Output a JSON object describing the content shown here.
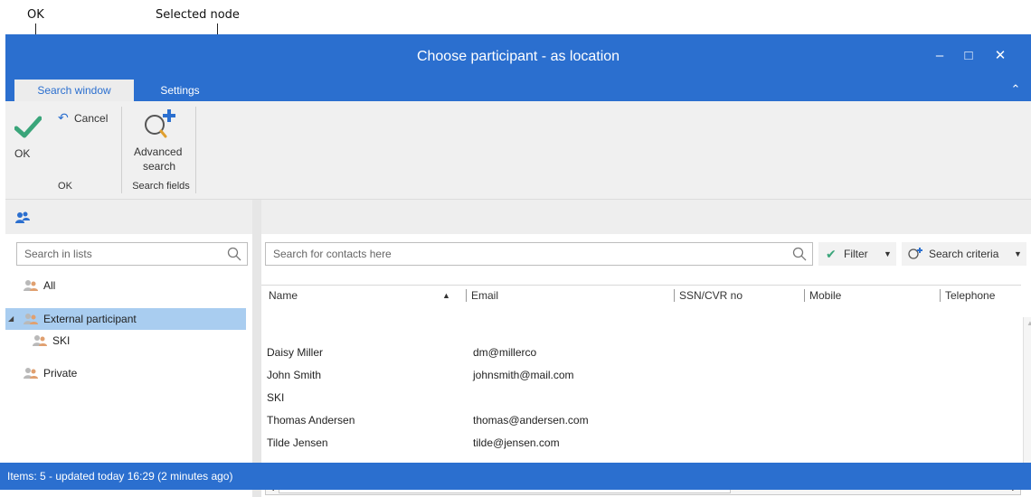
{
  "callouts": {
    "ok": "OK",
    "selected_node": "Selected node"
  },
  "window": {
    "title": "Choose participant - as location",
    "controls": {
      "minimize": "–",
      "maximize": "□",
      "close": "✕"
    }
  },
  "tabs": [
    {
      "label": "Search window"
    },
    {
      "label": "Settings"
    }
  ],
  "collapse_icon": "⌃",
  "ribbon": {
    "ok_label": "OK",
    "cancel_label": "Cancel",
    "advanced_search_label_1": "Advanced",
    "advanced_search_label_2": "search",
    "group_ok": "OK",
    "group_search_fields": "Search fields"
  },
  "left": {
    "search_placeholder": "Search in lists",
    "tree": [
      {
        "label": "All"
      },
      {
        "label": "External participant"
      },
      {
        "label": "SKI"
      },
      {
        "label": "Private"
      }
    ],
    "expand_glyph": "◢"
  },
  "right": {
    "search_placeholder": "Search for contacts here",
    "filter_label": "Filter",
    "search_criteria_label": "Search criteria",
    "columns": [
      "Name",
      "Email",
      "SSN/CVR no",
      "Mobile",
      "Telephone"
    ],
    "sort_glyph": "▲",
    "rows": [
      {
        "name": "Daisy Miller",
        "email": "dm@millerco"
      },
      {
        "name": "John Smith",
        "email": "johnsmith@mail.com"
      },
      {
        "name": "SKI",
        "email": ""
      },
      {
        "name": "Thomas Andersen",
        "email": "thomas@andersen.com"
      },
      {
        "name": "Tilde Jensen",
        "email": "tilde@jensen.com"
      }
    ]
  },
  "status": "Items: 5 - updated today 16:29 (2 minutes ago)",
  "colors": {
    "accent": "#2b6fcf",
    "selection": "#a9cdf0",
    "check": "#3aa57a"
  }
}
